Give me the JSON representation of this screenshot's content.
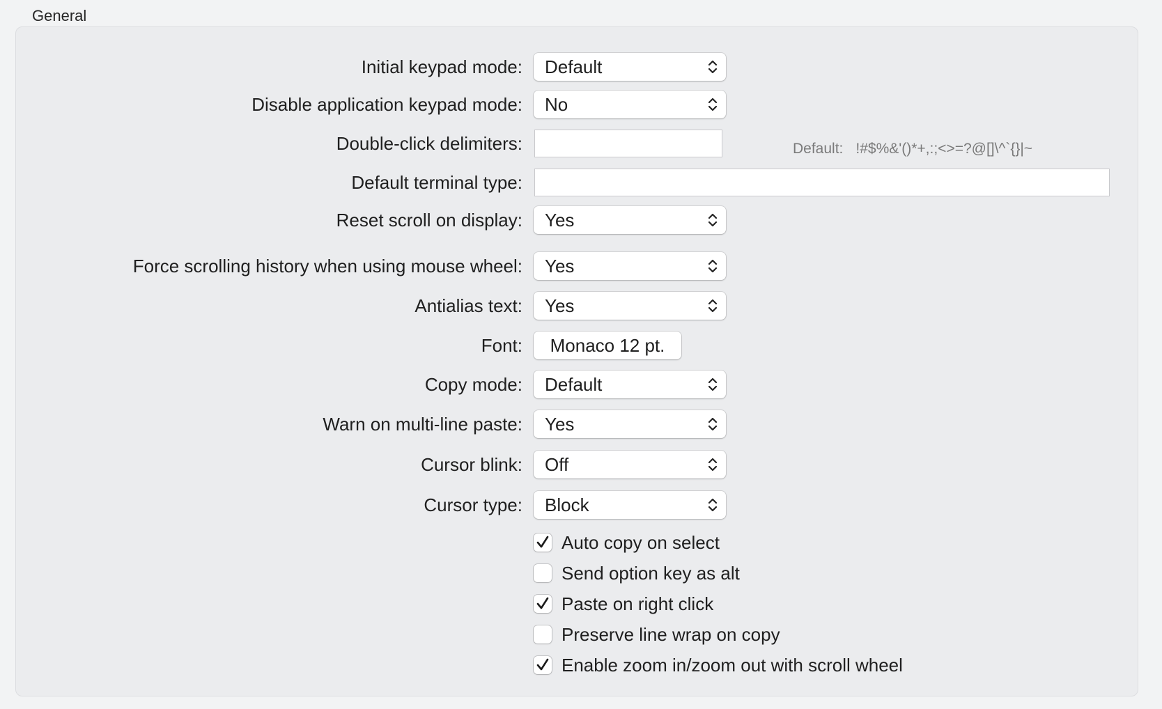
{
  "section": {
    "title": "General"
  },
  "settings": {
    "initial_keypad_mode": {
      "label": "Initial keypad mode:",
      "value": "Default"
    },
    "disable_app_keypad_mode": {
      "label": "Disable application keypad mode:",
      "value": "No"
    },
    "double_click_delimiters": {
      "label": "Double-click delimiters:",
      "value": "",
      "hint_label": "Default:",
      "hint_value": "!#$%&'()*+,:;<>=?@[]\\^`{}|~"
    },
    "default_terminal_type": {
      "label": "Default terminal type:",
      "value": ""
    },
    "reset_scroll_on_display": {
      "label": "Reset scroll on display:",
      "value": "Yes"
    },
    "force_scrolling_history": {
      "label": "Force scrolling history when using mouse wheel:",
      "value": "Yes"
    },
    "antialias_text": {
      "label": "Antialias text:",
      "value": "Yes"
    },
    "font": {
      "label": "Font:",
      "value": "Monaco 12 pt."
    },
    "copy_mode": {
      "label": "Copy mode:",
      "value": "Default"
    },
    "warn_multiline_paste": {
      "label": "Warn on multi-line paste:",
      "value": "Yes"
    },
    "cursor_blink": {
      "label": "Cursor blink:",
      "value": "Off"
    },
    "cursor_type": {
      "label": "Cursor type:",
      "value": "Block"
    }
  },
  "checkboxes": [
    {
      "label": "Auto copy on select",
      "checked": true
    },
    {
      "label": "Send option key as alt",
      "checked": false
    },
    {
      "label": "Paste on right click",
      "checked": true
    },
    {
      "label": "Preserve line wrap on copy",
      "checked": false
    },
    {
      "label": "Enable zoom in/zoom out with scroll wheel",
      "checked": true
    }
  ],
  "icons": {
    "popup_arrows": "chevron-up-down-icon",
    "checkmark": "checkmark-icon"
  },
  "colors": {
    "background": "#f2f3f4",
    "group_box": "#ebecee",
    "hint_text": "#7a7a7a"
  }
}
